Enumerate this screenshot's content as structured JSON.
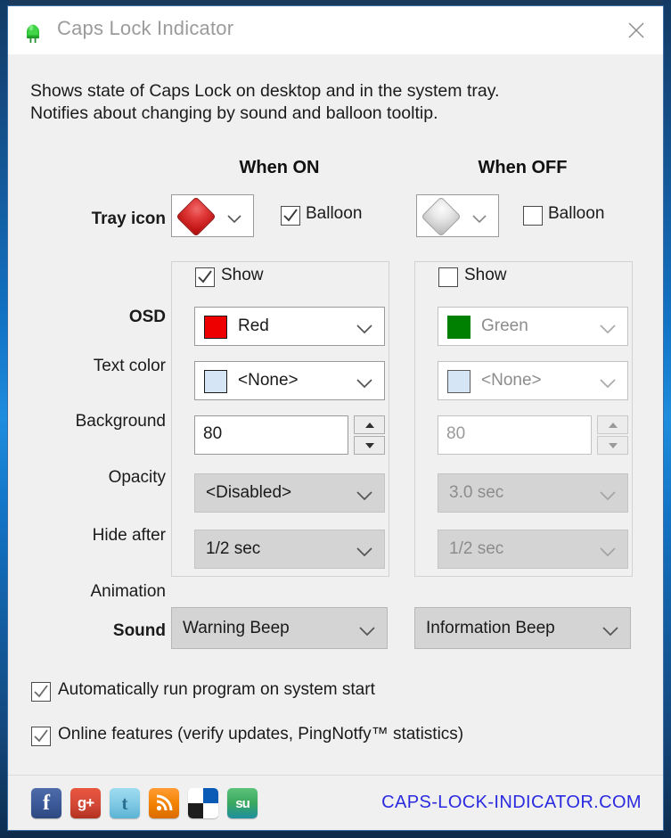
{
  "window": {
    "title": "Caps Lock Indicator",
    "app_icon": "led-bulb-icon",
    "close_label": "×"
  },
  "description": "Shows state of Caps Lock on desktop and in the system tray.\nNotifies about changing by sound and balloon tooltip.",
  "columns": {
    "on_header": "When ON",
    "off_header": "When OFF"
  },
  "labels": {
    "tray_icon": "Tray icon",
    "osd": "OSD",
    "text_color": "Text color",
    "background": "Background",
    "opacity": "Opacity",
    "hide_after": "Hide after",
    "animation": "Animation",
    "sound": "Sound",
    "show": "Show",
    "balloon": "Balloon"
  },
  "on": {
    "tray_icon_value": "red-diamond-icon",
    "tray_icon_color": "#d02020",
    "balloon_checked": true,
    "show_checked": true,
    "text_color_name": "Red",
    "text_color_hex": "#ee0000",
    "background_name": "<None>",
    "background_hex": "#d6e5f5",
    "opacity": "80",
    "hide_after": "<Disabled>",
    "animation": "1/2 sec",
    "sound": "Warning Beep"
  },
  "off": {
    "tray_icon_value": "grey-diamond-icon",
    "tray_icon_color": "#d5d5d5",
    "balloon_checked": false,
    "show_checked": false,
    "text_color_name": "Green",
    "text_color_hex": "#008000",
    "background_name": "<None>",
    "background_hex": "#d6e5f5",
    "opacity": "80",
    "hide_after": "3.0 sec",
    "animation": "1/2 sec",
    "sound": "Information Beep"
  },
  "options": {
    "autorun_label": "Automatically run program on system start",
    "autorun_checked": true,
    "online_label": "Online features (verify updates, PingNotfy™ statistics)",
    "online_checked": true
  },
  "footer": {
    "social": [
      {
        "name": "facebook-icon",
        "glyph": "f"
      },
      {
        "name": "google-plus-icon",
        "glyph": "g+"
      },
      {
        "name": "twitter-icon",
        "glyph": "t"
      },
      {
        "name": "rss-icon",
        "glyph": ""
      },
      {
        "name": "delicious-icon",
        "glyph": ""
      },
      {
        "name": "stumbleupon-icon",
        "glyph": "su"
      }
    ],
    "site_url": "CAPS-LOCK-INDICATOR.COM",
    "site_url_color": "#2a2ae0"
  }
}
